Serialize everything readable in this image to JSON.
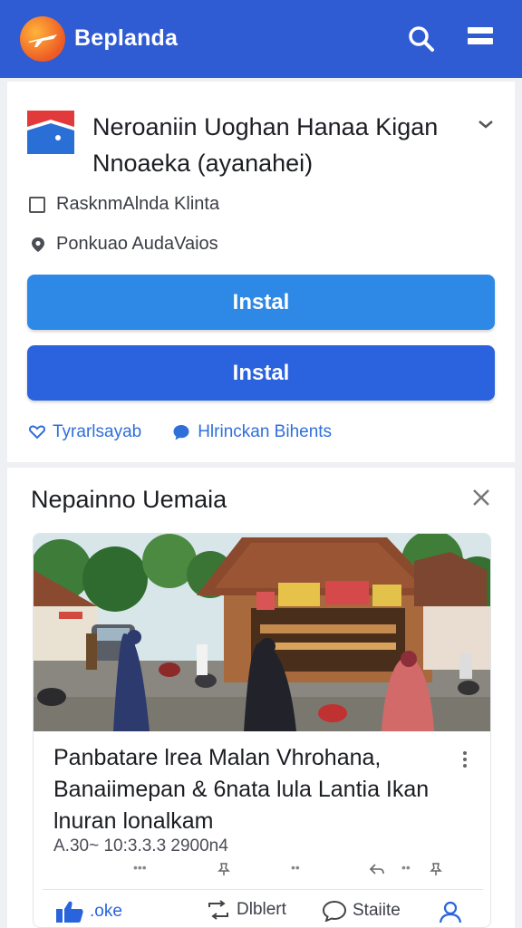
{
  "header": {
    "app_name": "Beplanda",
    "brand_color": "#2f5bd3",
    "search_icon": "search-icon",
    "menu_icon": "menu-icon"
  },
  "app_card": {
    "title": "Neroaniin Uoghan  Hanaa Kigan Nnoaeka (ayanahei)",
    "checkbox_label": "RasknmAlnda Klinta",
    "location_label": "Ponkuao  AudaVaios",
    "install_primary": "Instal",
    "install_secondary": "Instal",
    "link_left": "Tyrarlsayab",
    "link_right": "Hlrinckan Bihents",
    "colors": {
      "install_primary": "#2e89e6",
      "install_secondary": "#2b62dd",
      "link": "#2f6fd9"
    }
  },
  "news_section": {
    "title": "Nepainno Uemaia",
    "article": {
      "headline": "Panbatare lrea Malan Vhrohana, Banaiimepan & 6nata lula Lantia Ikan lnuran lonalkam",
      "timestamp": "A.30~ 10:3.3.3 2900n4"
    },
    "actions": {
      "like": ".oke",
      "share": "Dlblert",
      "comment": "Staiite"
    }
  }
}
